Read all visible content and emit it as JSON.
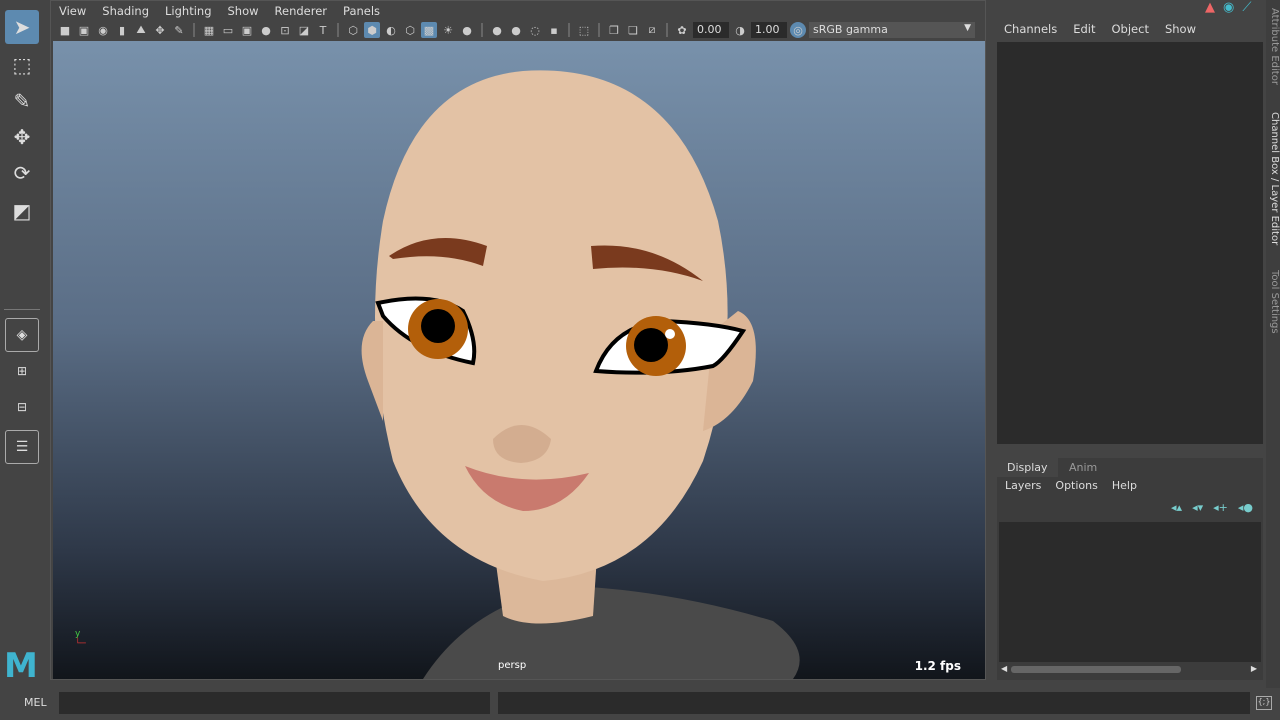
{
  "viewport": {
    "menu": [
      "View",
      "Shading",
      "Lighting",
      "Show",
      "Renderer",
      "Panels"
    ],
    "exposure": "0.00",
    "gamma": "1.00",
    "color_space": "sRGB gamma",
    "camera": "persp",
    "fps": "1.2 fps"
  },
  "channel_box": {
    "menu": [
      "Channels",
      "Edit",
      "Object",
      "Show"
    ]
  },
  "side_tabs": [
    "Attribute Editor",
    "Channel Box / Layer Editor",
    "Tool Settings"
  ],
  "layer_editor": {
    "tabs": [
      "Display",
      "Anim"
    ],
    "menu": [
      "Layers",
      "Options",
      "Help"
    ]
  },
  "command_line": {
    "label": "MEL"
  },
  "colors": {
    "accent": "#5d8ab0",
    "panel": "#444444",
    "field": "#2b2b2b"
  }
}
